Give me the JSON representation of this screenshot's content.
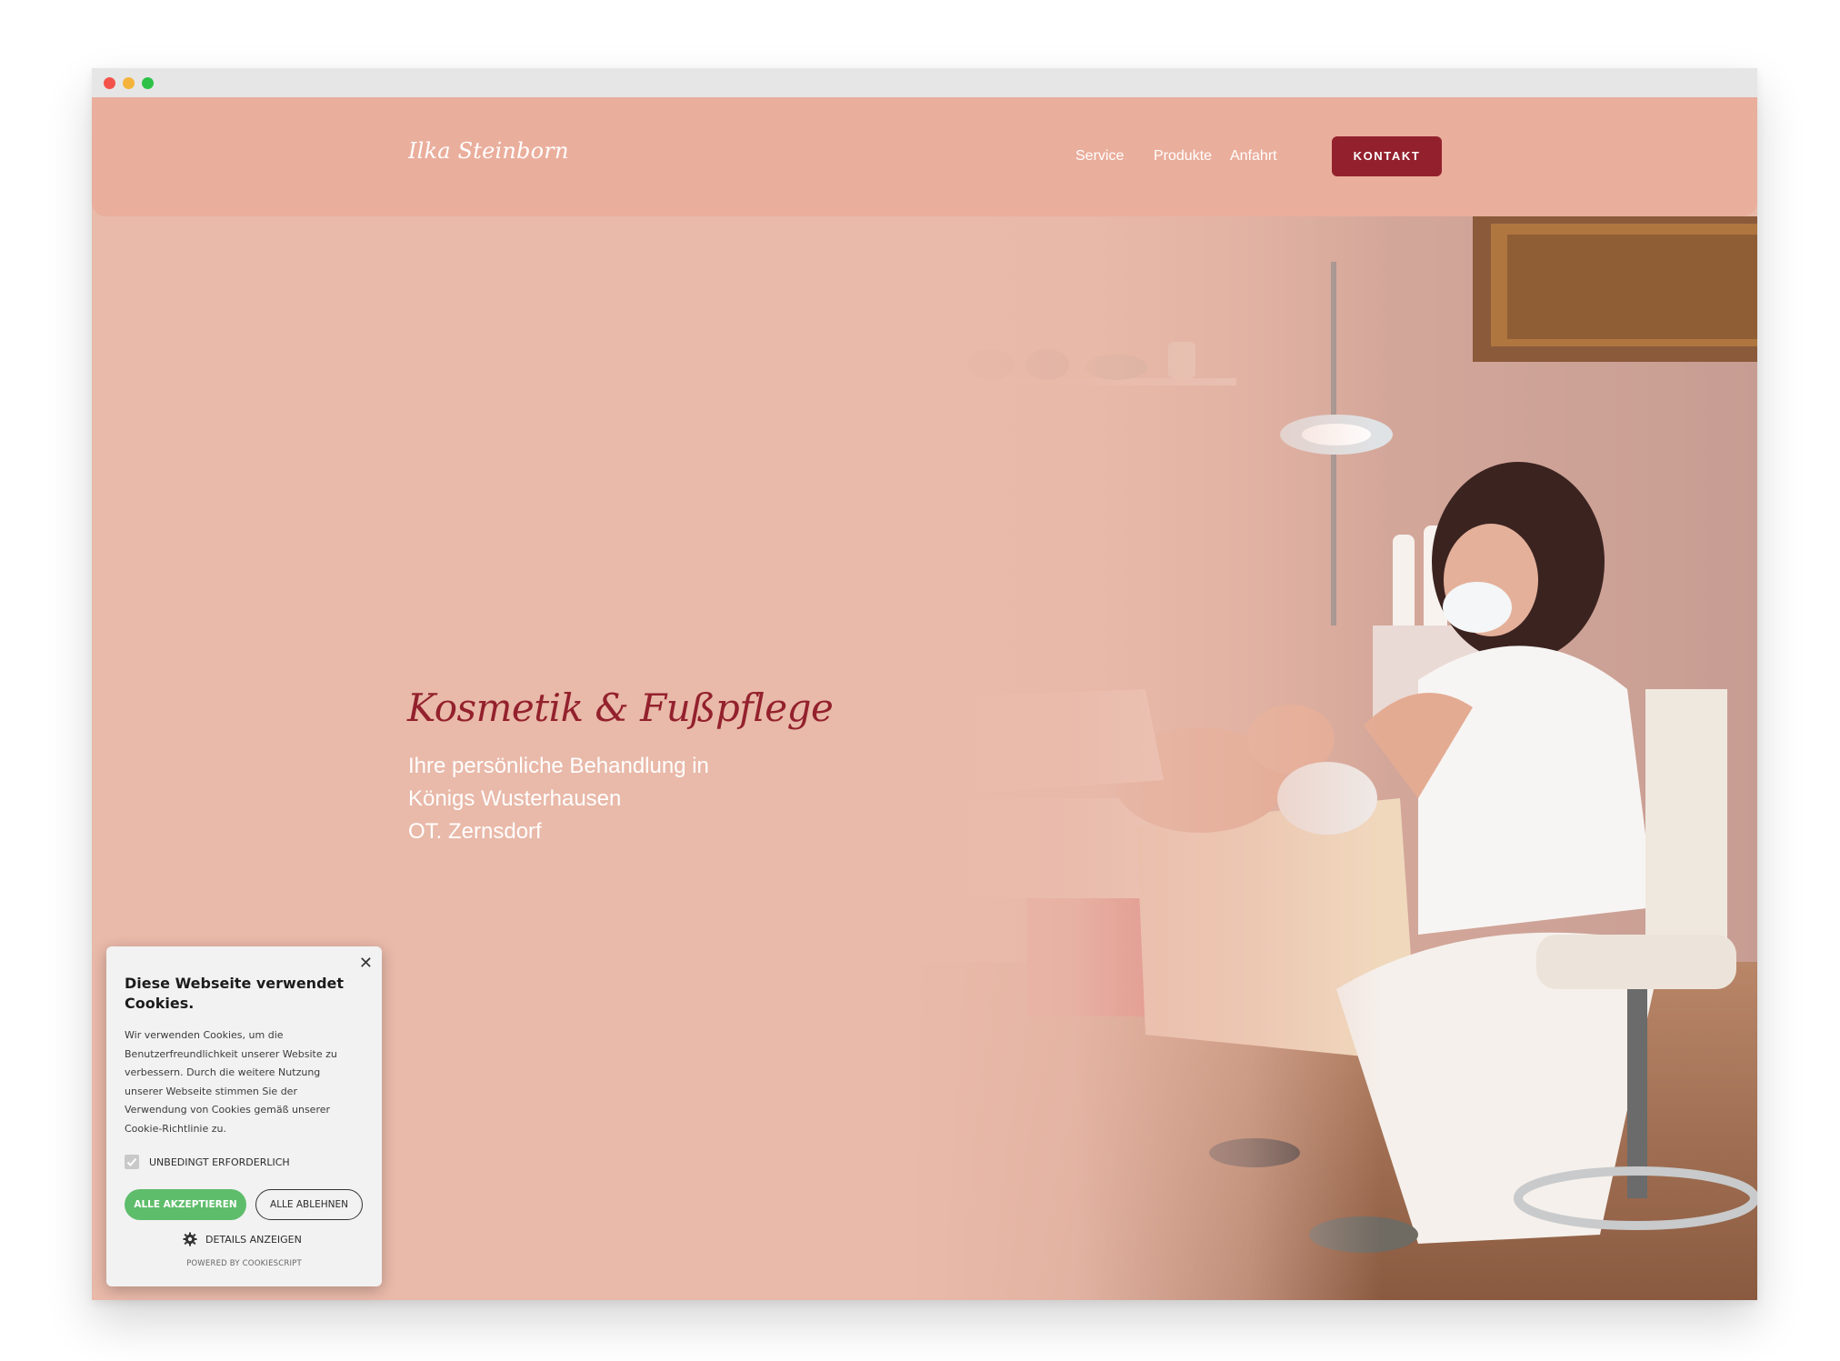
{
  "header": {
    "logo": "Ilka Steinborn",
    "nav": [
      "Service",
      "Produkte",
      "Anfahrt"
    ],
    "cta": "KONTAKT"
  },
  "hero": {
    "headline": "Kosmetik & Fußpflege",
    "lines": [
      "Ihre persönliche Behandlung in",
      "Königs Wusterhausen",
      "OT. Zernsdorf"
    ]
  },
  "cookie": {
    "title": "Diese Webseite verwendet Cookies.",
    "text": "Wir verwenden Cookies, um die Benutzerfreundlichkeit unserer Website zu verbessern. Durch die weitere Nutzung unserer Webseite stimmen Sie der Verwendung von Cookies gemäß unserer Cookie-Richtlinie zu.",
    "checkbox": "UNBEDINGT ERFORDERLICH",
    "accept": "ALLE AKZEPTIEREN",
    "decline": "ALLE ABLEHNEN",
    "details": "DETAILS ANZEIGEN",
    "powered": "POWERED BY COOKIESCRIPT"
  },
  "colors": {
    "background": "#e9b9a9",
    "header": "#eaae9c",
    "accent": "#93212d",
    "accept": "#5ebd6b"
  }
}
